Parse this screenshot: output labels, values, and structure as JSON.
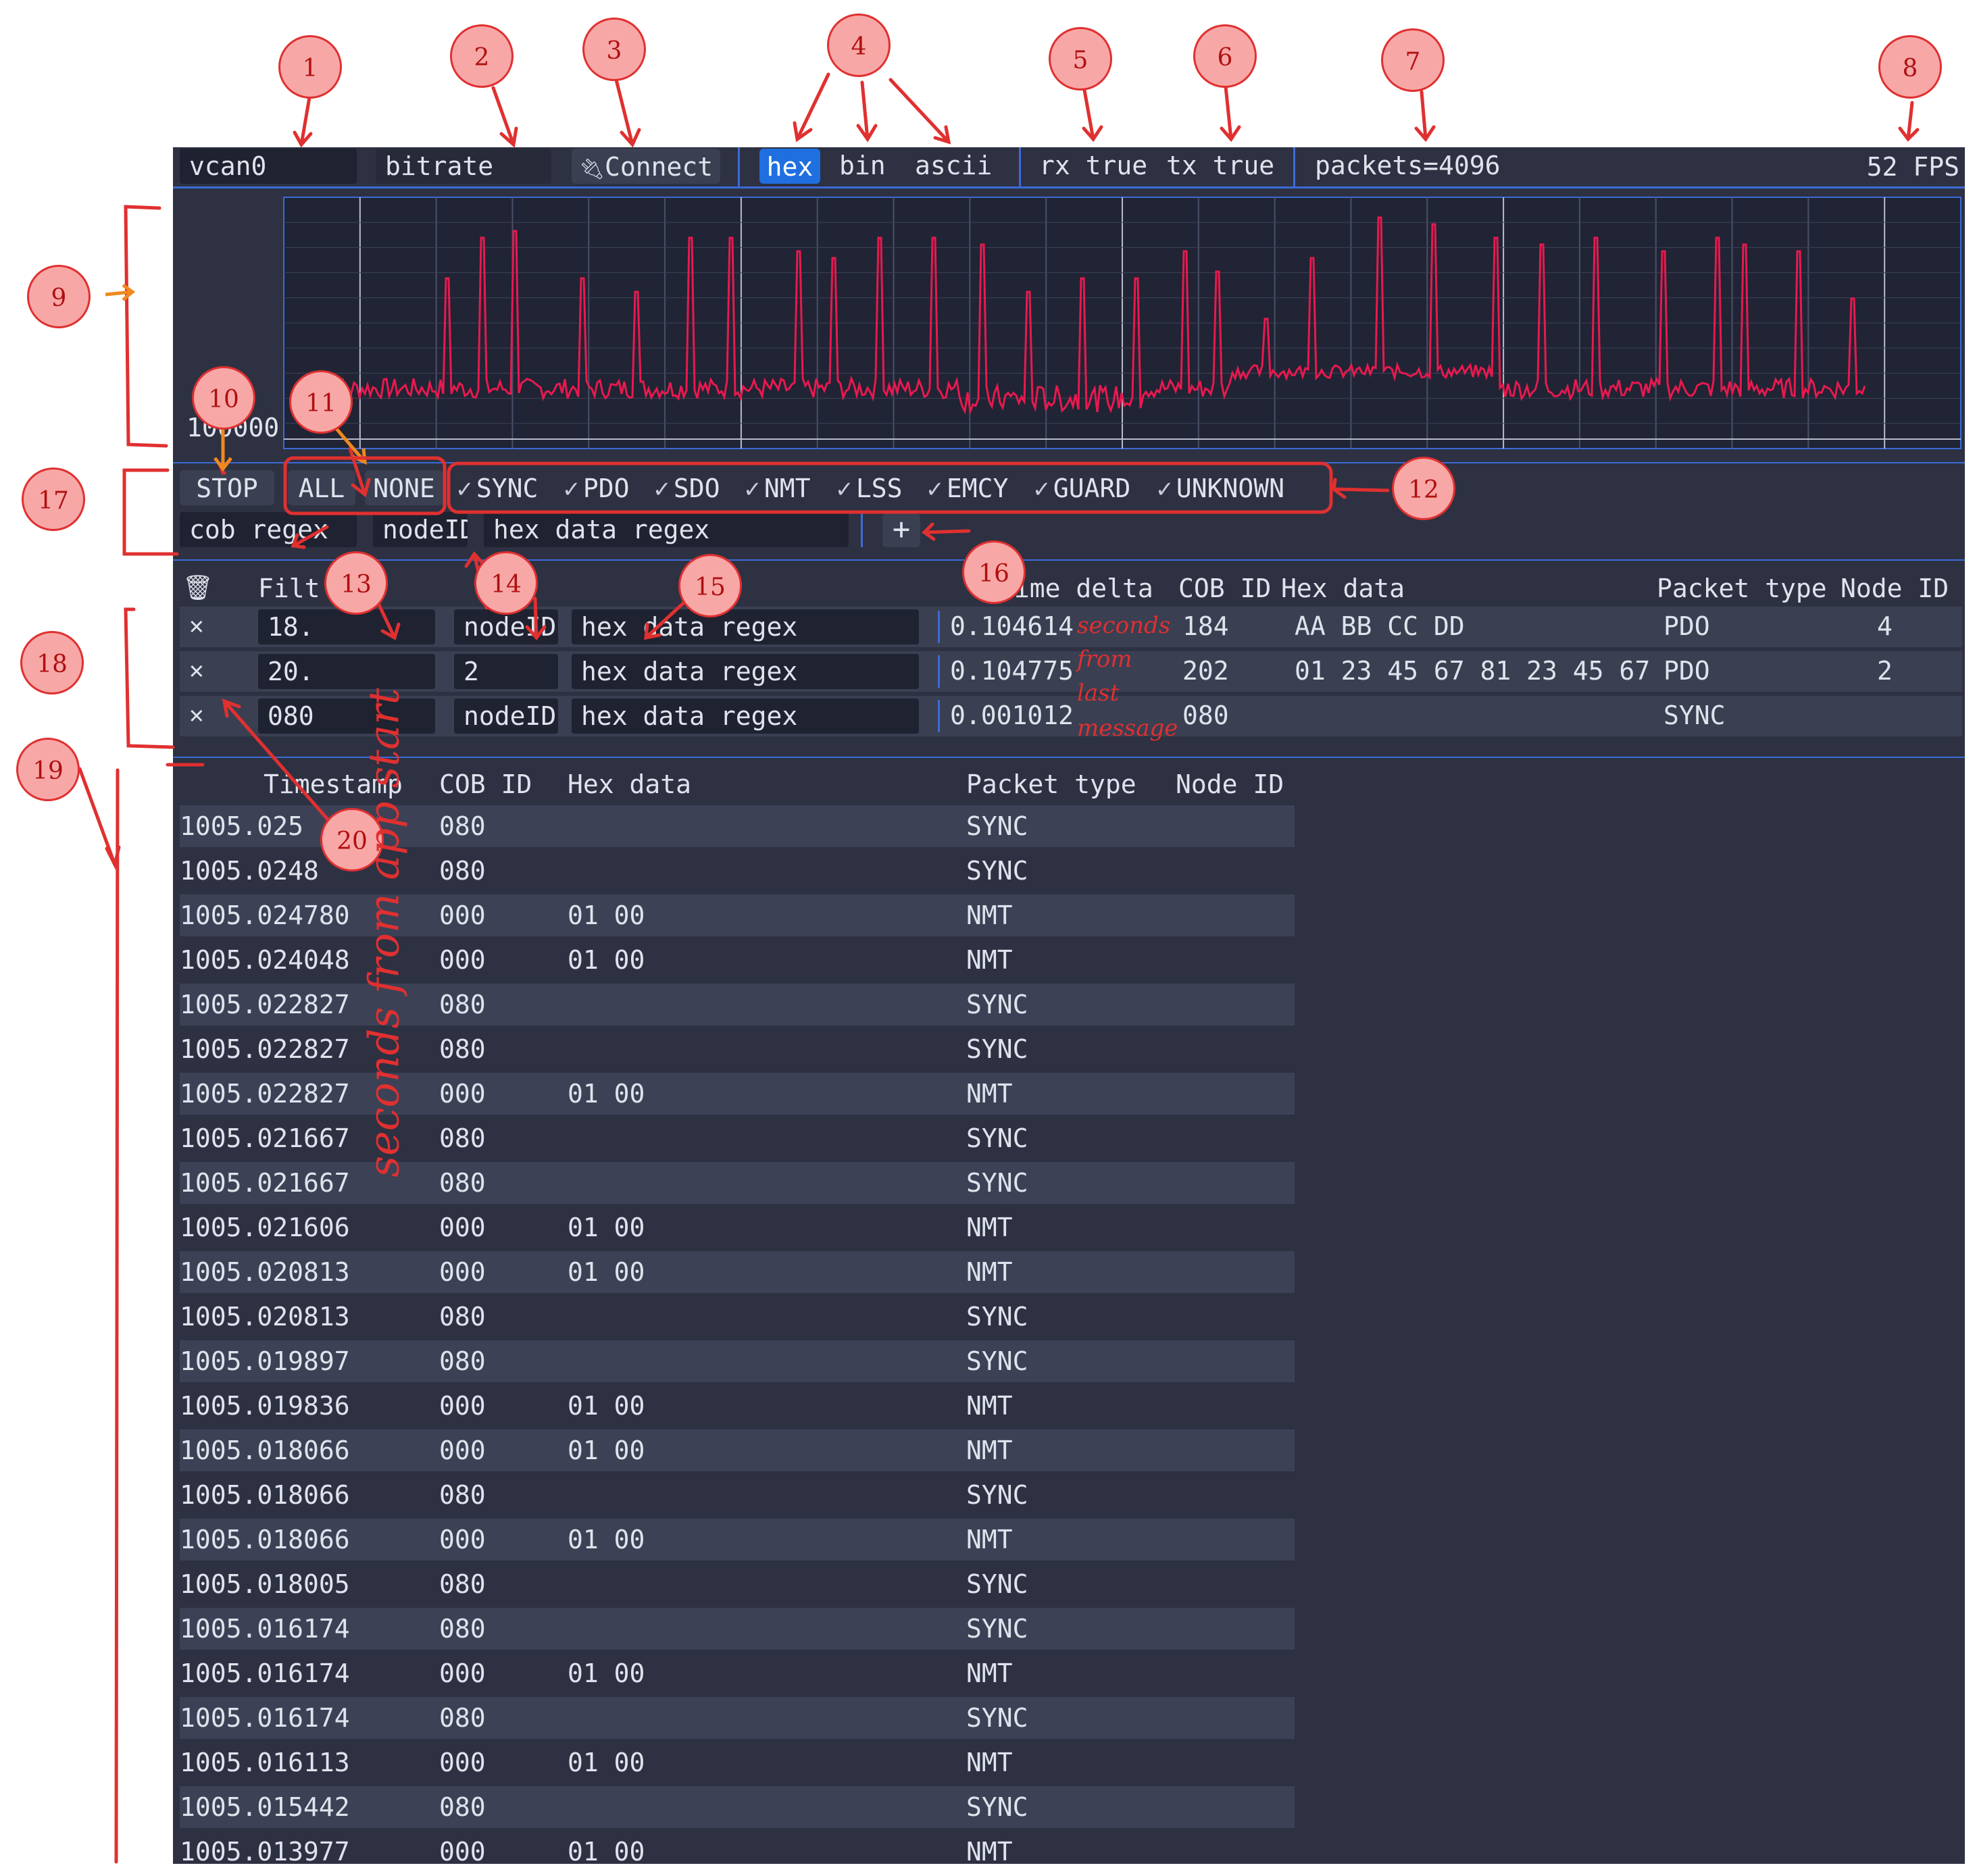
{
  "toolbar": {
    "interface": "vcan0",
    "bitrate_placeholder": "bitrate",
    "connect_label": "Connect",
    "formats": [
      "hex",
      "bin",
      "ascii"
    ],
    "rx_status": "rx true",
    "tx_status": "tx true",
    "packets": "packets=4096",
    "fps": "52 FPS"
  },
  "graph": {
    "y_label": "100000"
  },
  "controls": {
    "stop_label": "STOP",
    "all_label": "ALL",
    "none_label": "NONE",
    "packet_types": [
      "SYNC",
      "PDO",
      "SDO",
      "NMT",
      "LSS",
      "EMCY",
      "GUARD",
      "UNKNOWN"
    ],
    "cob_placeholder": "cob regex",
    "node_placeholder": "nodeID",
    "hex_placeholder": "hex data regex",
    "add_label": "+"
  },
  "filters": {
    "headers": [
      "Filt",
      "Time delta",
      "COB ID",
      "Hex data",
      "Packet type",
      "Node ID"
    ],
    "rows": [
      {
        "cob": "18.",
        "node": "nodeID",
        "hex": "hex data regex",
        "delta": "0.104614",
        "cob_id": "184",
        "data": "AA BB CC DD",
        "type": "PDO",
        "node_id": "4"
      },
      {
        "cob": "20.",
        "node": "2",
        "hex": "hex data regex",
        "delta": "0.104775",
        "cob_id": "202",
        "data": "01 23 45 67 81 23 45 67",
        "type": "PDO",
        "node_id": "2"
      },
      {
        "cob": "080",
        "node": "nodeID",
        "hex": "hex data regex",
        "delta": "0.001012",
        "cob_id": "080",
        "data": "",
        "type": "SYNC",
        "node_id": ""
      }
    ]
  },
  "log": {
    "headers": [
      "Timestamp",
      "COB ID",
      "Hex data",
      "Packet type",
      "Node ID"
    ],
    "rows": [
      [
        "1005.025",
        "080",
        "",
        "SYNC"
      ],
      [
        "1005.0248",
        "080",
        "",
        "SYNC"
      ],
      [
        "1005.024780",
        "000",
        "01 00",
        "NMT"
      ],
      [
        "1005.024048",
        "000",
        "01 00",
        "NMT"
      ],
      [
        "1005.022827",
        "080",
        "",
        "SYNC"
      ],
      [
        "1005.022827",
        "080",
        "",
        "SYNC"
      ],
      [
        "1005.022827",
        "000",
        "01 00",
        "NMT"
      ],
      [
        "1005.021667",
        "080",
        "",
        "SYNC"
      ],
      [
        "1005.021667",
        "080",
        "",
        "SYNC"
      ],
      [
        "1005.021606",
        "000",
        "01 00",
        "NMT"
      ],
      [
        "1005.020813",
        "000",
        "01 00",
        "NMT"
      ],
      [
        "1005.020813",
        "080",
        "",
        "SYNC"
      ],
      [
        "1005.019897",
        "080",
        "",
        "SYNC"
      ],
      [
        "1005.019836",
        "000",
        "01 00",
        "NMT"
      ],
      [
        "1005.018066",
        "000",
        "01 00",
        "NMT"
      ],
      [
        "1005.018066",
        "080",
        "",
        "SYNC"
      ],
      [
        "1005.018066",
        "000",
        "01 00",
        "NMT"
      ],
      [
        "1005.018005",
        "080",
        "",
        "SYNC"
      ],
      [
        "1005.016174",
        "080",
        "",
        "SYNC"
      ],
      [
        "1005.016174",
        "000",
        "01 00",
        "NMT"
      ],
      [
        "1005.016174",
        "080",
        "",
        "SYNC"
      ],
      [
        "1005.016113",
        "000",
        "01 00",
        "NMT"
      ],
      [
        "1005.015442",
        "080",
        "",
        "SYNC"
      ],
      [
        "1005.013977",
        "000",
        "01 00",
        "NMT"
      ]
    ]
  },
  "annotations": {
    "markers": [
      "1",
      "2",
      "3",
      "4",
      "5",
      "6",
      "7",
      "8",
      "9",
      "10",
      "11",
      "12",
      "13",
      "14",
      "15",
      "16",
      "17",
      "18",
      "19",
      "20"
    ],
    "delta_note": [
      "seconds",
      "from",
      "last",
      "message"
    ],
    "timestamp_note": "seconds from app start"
  },
  "colors": {
    "background": "#2d3142",
    "accent": "#3b6bd6",
    "graph_line": "#e8194f",
    "annotation": "#e03030"
  }
}
